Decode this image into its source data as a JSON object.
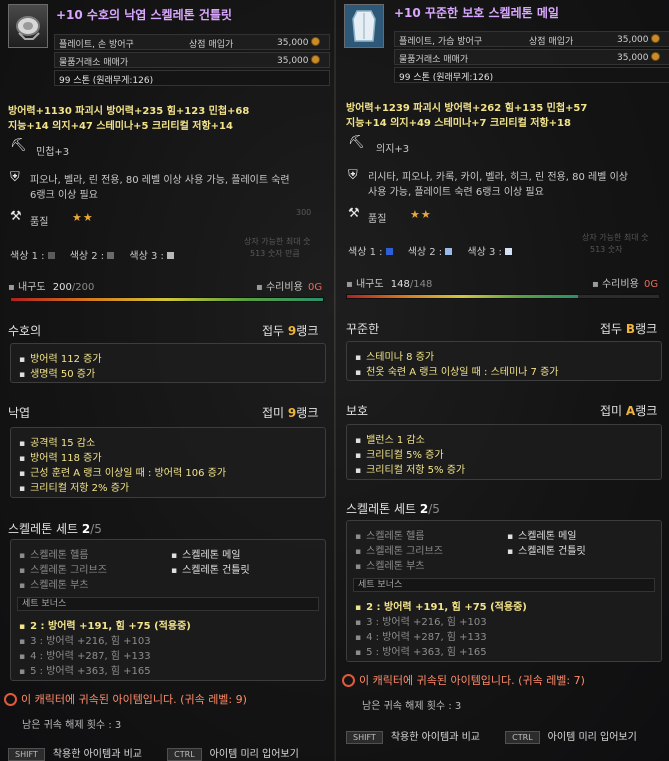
{
  "left": {
    "title": "+10 수호의 낙엽 스켈레톤 건틀릿",
    "type_label": "플레이트, 손 방어구",
    "shop_label": "상점 매입가",
    "shop_price": "35,000",
    "exchange_label": "물품거래소 매매가",
    "exchange_price": "35,000",
    "weight": "99 스톤 (원래무게:126)",
    "stats1": "방어력+1130   파괴시 방어력+235   힘+123   민첩+68",
    "stats2": "지능+14   의지+47   스테미나+5   크리티컬 저항+14",
    "enchant": "민첩+3",
    "restriction1": "피오나, 벨라, 린 전용, 80 레벨 이상 사용 가능, 플레이트 숙련",
    "restriction2": "6랭크 이상 필요",
    "quality_label": "품질",
    "quality_stars": "★★",
    "color1_label": "색상 1 :",
    "color2_label": "색상 2 :",
    "color3_label": "색상 3 :",
    "color1": "#5a5a5a",
    "color2": "#6a6a6a",
    "color3": "#b8b8b8",
    "faded_hint1": "상자 가능한 최대 숫",
    "faded_hint2": "513 숫자 만큼",
    "faded_nums": "300",
    "durability_label": "내구도",
    "durability_value": "200",
    "durability_max": "/200",
    "durability_ratio": 1.0,
    "repair_label": "수리비용",
    "repair_value": "0G",
    "sections": [
      {
        "name": "수호의",
        "rank_prefix": "접두",
        "rank_value": "9",
        "rank_suffix": "랭크",
        "lines": [
          "방어력 112 증가",
          "생명력 50 증가"
        ]
      },
      {
        "name": "낙엽",
        "rank_prefix": "접미",
        "rank_value": "9",
        "rank_suffix": "랭크",
        "lines": [
          "공격력 15 감소",
          "방어력 118 증가",
          "근성 훈련 A 랭크 이상일 때 : 방어력 106 증가",
          "크리티컬 저항 2% 증가"
        ]
      }
    ],
    "set_title": "스켈레톤 세트",
    "set_count": "2",
    "set_total": "/5",
    "set_items": [
      "스켈레톤 헬름",
      "스켈레톤 메일",
      "스켈레톤 그리브즈",
      "스켈레톤 건틀릿",
      "스켈레톤 부츠"
    ],
    "bonus_header": "세트 보너스",
    "bonuses": [
      "2 : 방어력 +191, 힘 +75 (적용중)",
      "3 : 방어력 +216, 힘 +103",
      "4 : 방어력 +287, 힘 +133",
      "5 : 방어력 +363, 힘 +165"
    ],
    "bind_text": "이 캐릭터에 귀속된 아이템입니다. (귀속 레벨: 9)",
    "remain_text": "남은 귀속 해제 횟수 : 3",
    "key1": "SHIFT",
    "key1_label": "착용한 아이템과 비교",
    "key2": "CTRL",
    "key2_label": "아이템 미리 입어보기"
  },
  "right": {
    "title": "+10 꾸준한 보호 스켈레톤 메일",
    "type_label": "플레이트, 가슴 방어구",
    "shop_label": "상점 매입가",
    "shop_price": "35,000",
    "exchange_label": "물품거래소 매매가",
    "exchange_price": "35,000",
    "weight": "99 스톤 (원래무게:126)",
    "stats1": "방어력+1239   파괴시 방어력+262   힘+135   민첩+57",
    "stats2": "지능+14   의지+49   스테미나+7   크리티컬 저항+18",
    "enchant": "의지+3",
    "restriction1": "리시타, 피오나, 카록, 카이, 벨라, 히크, 린 전용, 80 레벨 이상",
    "restriction2": "사용 가능, 플레이트 숙련 6랭크 이상 필요",
    "quality_label": "품질",
    "quality_stars": "★★",
    "color1_label": "색상 1 :",
    "color2_label": "색상 2 :",
    "color3_label": "색상 3 :",
    "color1": "#2f5fd6",
    "color2": "#9ab8e8",
    "color3": "#d4e0f4",
    "faded_hint1": "상자 가능한 최대 숫",
    "faded_hint2": "513 숫자",
    "durability_label": "내구도",
    "durability_value": "148",
    "durability_max": "/148",
    "durability_ratio": 0.74,
    "repair_label": "수리비용",
    "repair_value": "0G",
    "sections": [
      {
        "name": "꾸준한",
        "rank_prefix": "접두",
        "rank_value": "B",
        "rank_suffix": "랭크",
        "lines": [
          "스테미나 8 증가",
          "천옷 숙련 A 랭크 이상일 때 : 스테미나 7 증가"
        ]
      },
      {
        "name": "보호",
        "rank_prefix": "접미",
        "rank_value": "A",
        "rank_suffix": "랭크",
        "lines": [
          "밸런스 1 감소",
          "크리티컬 5% 증가",
          "크리티컬 저항 5% 증가"
        ]
      }
    ],
    "set_title": "스켈레톤 세트",
    "set_count": "2",
    "set_total": "/5",
    "set_items": [
      "스켈레톤 헬름",
      "스켈레톤 메일",
      "스켈레톤 그리브즈",
      "스켈레톤 건틀릿",
      "스켈레톤 부츠"
    ],
    "bonus_header": "세트 보너스",
    "bonuses": [
      "2 : 방어력 +191, 힘 +75 (적용중)",
      "3 : 방어력 +216, 힘 +103",
      "4 : 방어력 +287, 힘 +133",
      "5 : 방어력 +363, 힘 +165"
    ],
    "bind_text": "이 캐릭터에 귀속된 아이템입니다. (귀속 레벨: 7)",
    "remain_text": "남은 귀속 해제 횟수 : 3",
    "key1": "SHIFT",
    "key1_label": "착용한 아이템과 비교",
    "key2": "CTRL",
    "key2_label": "아이템 미리 입어보기"
  }
}
